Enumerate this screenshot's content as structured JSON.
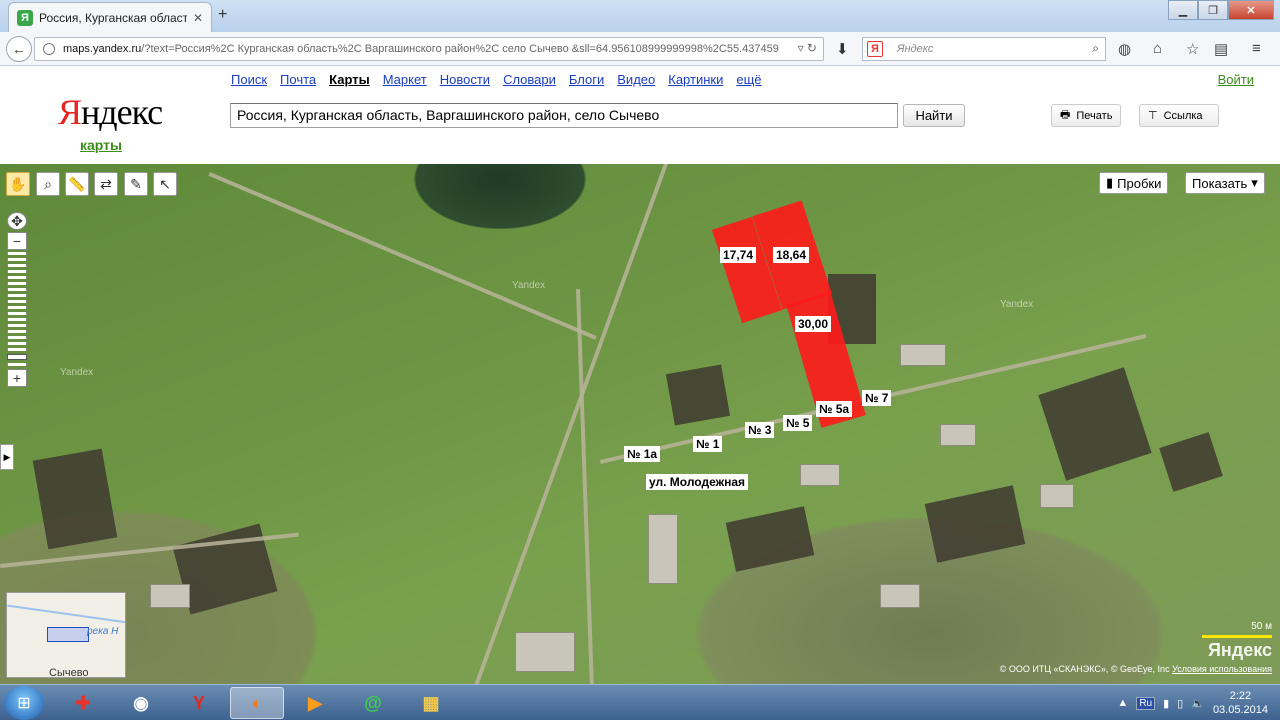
{
  "browser": {
    "tab_title": "Россия, Курганская область, ...",
    "tab_favicon": "Я",
    "url_host": "maps.yandex.ru",
    "url_rest": "/?text=Россия%2C Курганская область%2C Варгашинского район%2C село Сычево &sll=64.956108999999998%2C55.437459",
    "search_placeholder": "Яндекс",
    "search_engine_icon": "Я"
  },
  "yandex": {
    "logo_first": "Я",
    "logo_rest": "ндекс",
    "logo_sub": "карты",
    "services": [
      "Поиск",
      "Почта",
      "Карты",
      "Маркет",
      "Новости",
      "Словари",
      "Блоги",
      "Видео",
      "Картинки",
      "ещё"
    ],
    "active_service": "Карты",
    "login": "Войти",
    "query": "Россия, Курганская область, Варгашинского район, село Сычево",
    "find": "Найти",
    "print": "Печать",
    "link": "Ссылка"
  },
  "map": {
    "traffic": "Пробки",
    "show": "Показать",
    "parcels": [
      "17,74",
      "18,64",
      "30,00"
    ],
    "house_labels": [
      "№ 1а",
      "№ 1",
      "№ 3",
      "№ 5",
      "№ 5а",
      "№ 7"
    ],
    "street": "ул. Молодежная",
    "watermarks": [
      "Yandex",
      "Yandex",
      "Yandex"
    ],
    "minimap_river": "река Н",
    "minimap_town": "Сычево",
    "scale": "50 м",
    "brand": "Яндекс",
    "copyright": "© ООО ИТЦ «СКАНЭКС», © GeoEye, Inc",
    "terms": "Условия использования"
  },
  "taskbar": {
    "lang": "Ru",
    "time": "2:22",
    "date": "03.05.2014"
  },
  "colors": {
    "parcel": "#ff1a1a",
    "link": "#1a3dc1",
    "brand_red": "#e52620",
    "brand_green": "#3c8c1c"
  }
}
